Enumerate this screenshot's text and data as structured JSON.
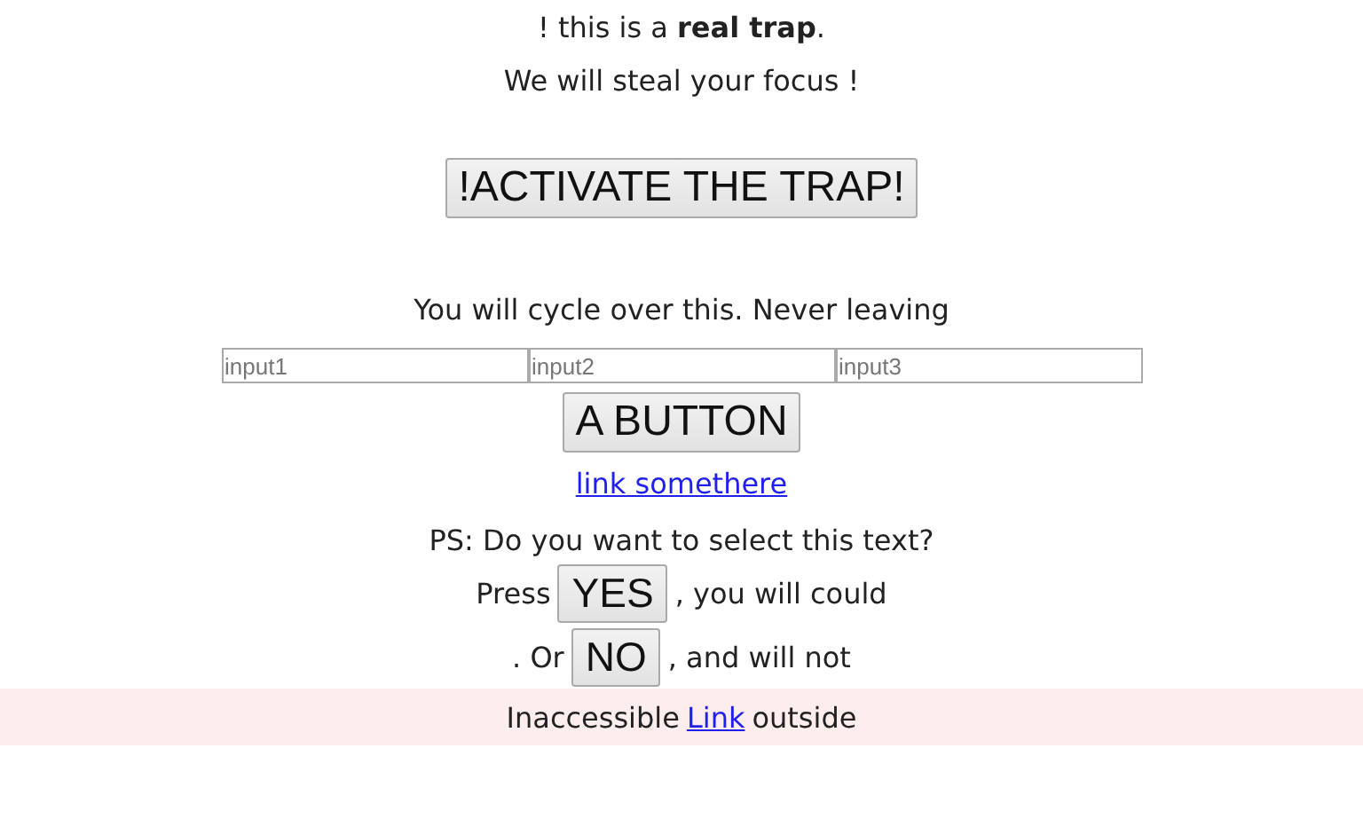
{
  "intro": [
    "! this is a **real trap**.",
    "We will steal your focus !"
  ],
  "trap_button": "!ACTIVATE THE TRAP!",
  "cycle_text": "You will cycle over this. Never leaving",
  "inputs": [
    {
      "placeholder": "input1"
    },
    {
      "placeholder": "input2"
    },
    {
      "placeholder": "input3"
    }
  ],
  "main_button": "A BUTTON",
  "link": "link somethere",
  "ps_text": "PS: Do you want to select this text?",
  "choices": [
    {
      "before": "Press",
      "button": "YES",
      "after": ", you will could"
    },
    {
      "before": ". Or",
      "button": "NO",
      "after": ", and will not"
    }
  ],
  "footer": {
    "before": "Inaccessible",
    "link": "Link",
    "after": "outside"
  }
}
